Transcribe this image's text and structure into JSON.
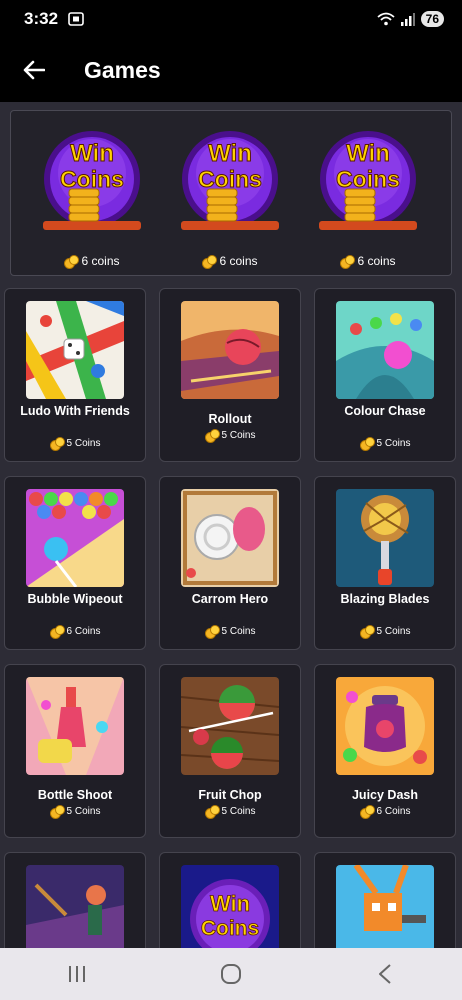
{
  "status": {
    "time": "3:32",
    "battery": "76"
  },
  "header": {
    "title": "Games",
    "back_icon": "back-arrow-icon"
  },
  "banner": {
    "items": [
      {
        "badge_line1": "Win",
        "badge_line2": "Coins",
        "price": "6 coins"
      },
      {
        "badge_line1": "Win",
        "badge_line2": "Coins",
        "price": "6 coins"
      },
      {
        "badge_line1": "Win",
        "badge_line2": "Coins",
        "price": "6 coins"
      }
    ]
  },
  "games": [
    {
      "name": "Ludo With Friends",
      "price": "5 Coins"
    },
    {
      "name": "Rollout",
      "price": "5 Coins"
    },
    {
      "name": "Colour Chase",
      "price": "5 Coins"
    },
    {
      "name": "Bubble Wipeout",
      "price": "6 Coins"
    },
    {
      "name": "Carrom Hero",
      "price": "5 Coins"
    },
    {
      "name": "Blazing Blades",
      "price": "5 Coins"
    },
    {
      "name": "Bottle Shoot",
      "price": "5 Coins"
    },
    {
      "name": "Fruit Chop",
      "price": "5 Coins"
    },
    {
      "name": "Juicy Dash",
      "price": "6 Coins"
    }
  ],
  "partial_row": {
    "badge_line1": "Win",
    "badge_line2": "Coins"
  },
  "colors": {
    "background": "#2d2c36",
    "card": "#1f1e26",
    "coin": "#f5b623",
    "badge_purple": "#6a1fb8"
  }
}
